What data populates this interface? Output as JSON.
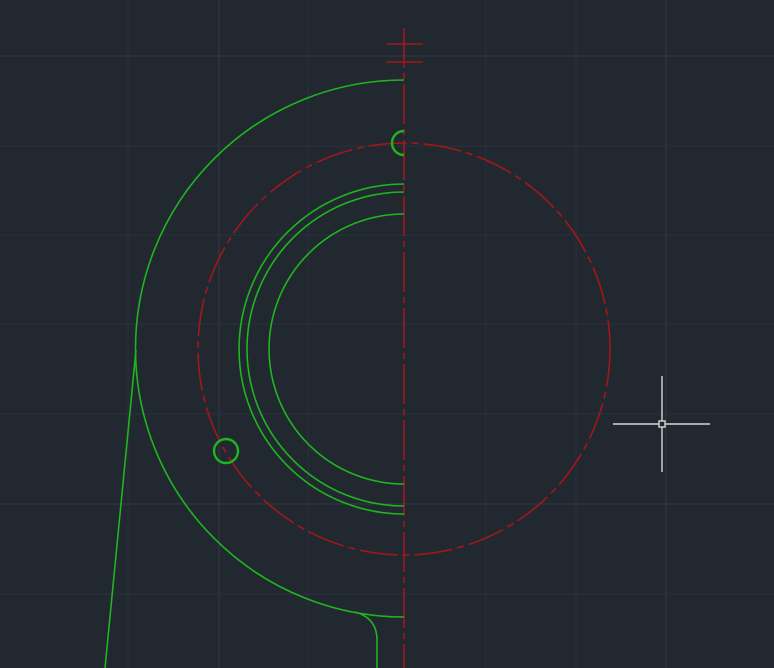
{
  "app": {
    "type": "cad-drawing-viewport"
  },
  "colors": {
    "background": "#212830",
    "grid_major": "#2f3742",
    "grid_minor": "#272e37",
    "geometry": "#1fb51f",
    "centerline": "#a3171b",
    "crosshair": "#d6d6d6"
  },
  "icons": {
    "cursor": "crosshair-cursor-icon",
    "snap": "pickbox-icon"
  }
}
